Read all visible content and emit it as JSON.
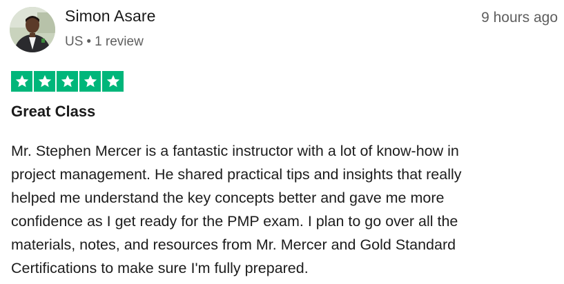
{
  "reviewer": {
    "name": "Simon Asare",
    "country": "US",
    "separator": "•",
    "review_count": "1 review",
    "avatar_icon": "profile-photo"
  },
  "review": {
    "date": "9 hours ago",
    "rating": 5,
    "rating_max": 5,
    "star_color": "#00b67a",
    "title": "Great Class",
    "body_lines": [
      "Mr. Stephen Mercer is a fantastic instructor with a lot of know-how in",
      "project management. He shared practical tips and insights that really",
      "helped me understand the key concepts better and gave me more",
      "confidence as I get ready for the PMP exam. I plan to go over all the",
      "materials, notes, and resources from Mr. Mercer and Gold Standard",
      "Certifications to make sure I'm fully prepared."
    ]
  }
}
